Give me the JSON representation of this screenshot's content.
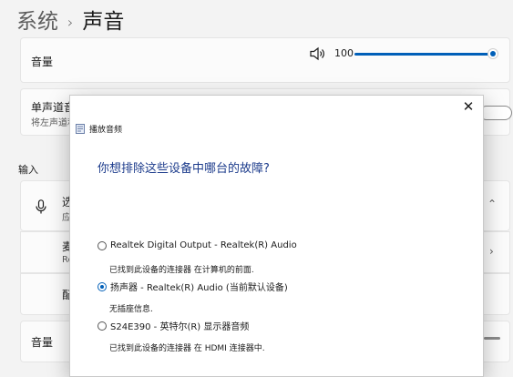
{
  "breadcrumb": {
    "parent": "系统",
    "current": "声音"
  },
  "volume_card": {
    "label": "音量",
    "value": "100",
    "level_percent": 100,
    "accent": "#005fb8"
  },
  "mono_card": {
    "title": "单声道音",
    "desc": "将左声道和",
    "toggle_on": false
  },
  "input_section": {
    "title": "输入"
  },
  "input_device_card": {
    "title": "选",
    "subtitle": "应"
  },
  "row_a": {
    "title": "麦",
    "subtitle": "Re"
  },
  "row_b": {
    "title": "配"
  },
  "input_volume": {
    "label": "音量"
  },
  "dialog": {
    "title": "播放音频",
    "question": "你想排除这些设备中哪台的故障?",
    "options": [
      {
        "label": "Realtek Digital Output - Realtek(R) Audio",
        "desc": "已找到此设备的连接器 在计算机的前面.",
        "checked": false
      },
      {
        "label": "扬声器 - Realtek(R) Audio (当前默认设备)",
        "desc": "无插座信息.",
        "checked": true
      },
      {
        "label": "S24E390 - 英特尔(R) 显示器音频",
        "desc": "已找到此设备的连接器 在 HDMI 连接器中.",
        "checked": false
      }
    ]
  }
}
